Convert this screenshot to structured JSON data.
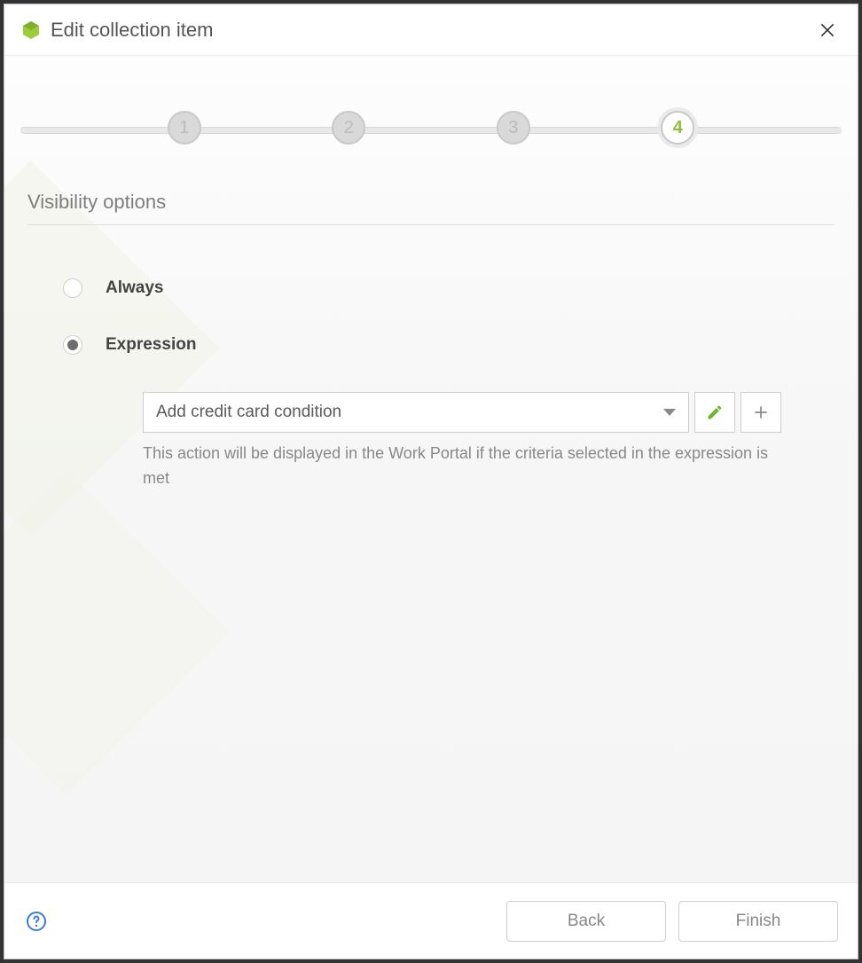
{
  "dialog": {
    "title": "Edit collection item"
  },
  "stepper": {
    "steps": [
      "1",
      "2",
      "3",
      "4"
    ],
    "active": 4
  },
  "section": {
    "title": "Visibility options"
  },
  "options": {
    "always_label": "Always",
    "expression_label": "Expression",
    "selected": "expression"
  },
  "expression": {
    "dropdown_value": "Add credit card condition",
    "helper_text": "This action will be displayed in the Work Portal if the criteria selected in the expression is met"
  },
  "icons": {
    "logo": "bizagi-logo",
    "close": "close-icon",
    "edit": "pencil-icon",
    "add": "plus-icon",
    "help": "help-icon",
    "caret": "chevron-down-icon"
  },
  "footer": {
    "back_label": "Back",
    "finish_label": "Finish"
  }
}
